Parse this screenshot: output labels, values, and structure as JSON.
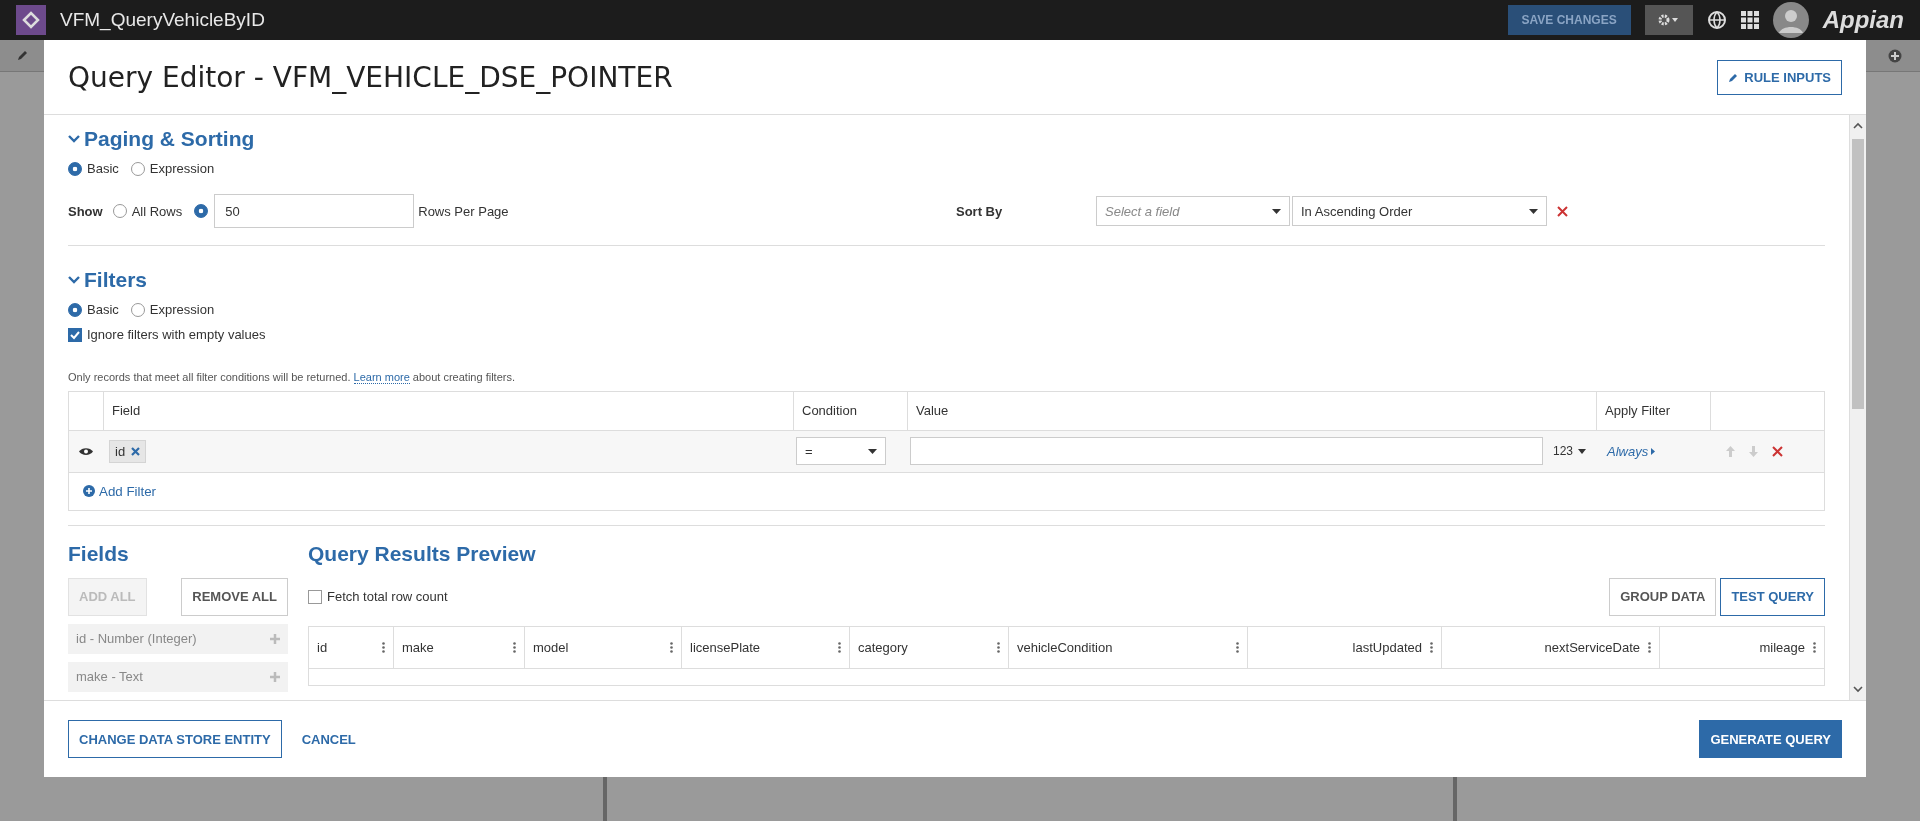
{
  "app_bar": {
    "title": "VFM_QueryVehicleByID",
    "save_button": "SAVE CHANGES",
    "logo": "Appian"
  },
  "dialog": {
    "title": "Query Editor - VFM_VEHICLE_DSE_POINTER",
    "rule_inputs_button": "RULE INPUTS"
  },
  "paging": {
    "heading": "Paging & Sorting",
    "expanded": true,
    "modes": [
      {
        "label": "Basic",
        "selected": true
      },
      {
        "label": "Expression",
        "selected": false
      }
    ],
    "show_label": "Show",
    "show_options": [
      {
        "label": "All Rows",
        "selected": false
      },
      {
        "selected": true
      }
    ],
    "rows_value": "50",
    "rows_suffix": "Rows Per Page",
    "sort_label": "Sort By",
    "sort_field_placeholder": "Select a field",
    "sort_order": "In Ascending Order"
  },
  "filters": {
    "heading": "Filters",
    "expanded": true,
    "modes": [
      {
        "label": "Basic",
        "selected": true
      },
      {
        "label": "Expression",
        "selected": false
      }
    ],
    "ignore_empty": {
      "label": "Ignore filters with empty values",
      "checked": true
    },
    "note_before": "Only records that meet all filter conditions will be returned.",
    "note_link": "Learn more",
    "note_after": "about creating filters.",
    "columns": [
      "Field",
      "Condition",
      "Value",
      "Apply Filter"
    ],
    "rows": [
      {
        "field": "id",
        "condition": "=",
        "type": "123",
        "apply": "Always"
      }
    ],
    "add_filter": "Add Filter"
  },
  "fields": {
    "heading": "Fields",
    "buttons": [
      {
        "label": "ADD ALL",
        "disabled": true
      },
      {
        "label": "REMOVE ALL",
        "disabled": false
      }
    ],
    "items": [
      "id - Number (Integer)",
      "make - Text"
    ]
  },
  "preview": {
    "heading": "Query Results Preview",
    "fetch_count": {
      "label": "Fetch total row count",
      "checked": false
    },
    "buttons": [
      {
        "label": "GROUP DATA",
        "primary": false
      },
      {
        "label": "TEST QUERY",
        "primary": true
      }
    ],
    "columns": [
      {
        "label": "id",
        "kind": "text"
      },
      {
        "label": "make",
        "kind": "text"
      },
      {
        "label": "model",
        "kind": "text"
      },
      {
        "label": "licensePlate",
        "kind": "text"
      },
      {
        "label": "category",
        "kind": "text"
      },
      {
        "label": "vehicleCondition",
        "kind": "text"
      },
      {
        "label": "lastUpdated",
        "kind": "number"
      },
      {
        "label": "nextServiceDate",
        "kind": "number"
      },
      {
        "label": "mileage",
        "kind": "number"
      }
    ]
  },
  "footer": {
    "change_entity_button": "CHANGE DATA STORE ENTITY",
    "cancel_link": "CANCEL",
    "generate_button": "GENERATE QUERY"
  }
}
